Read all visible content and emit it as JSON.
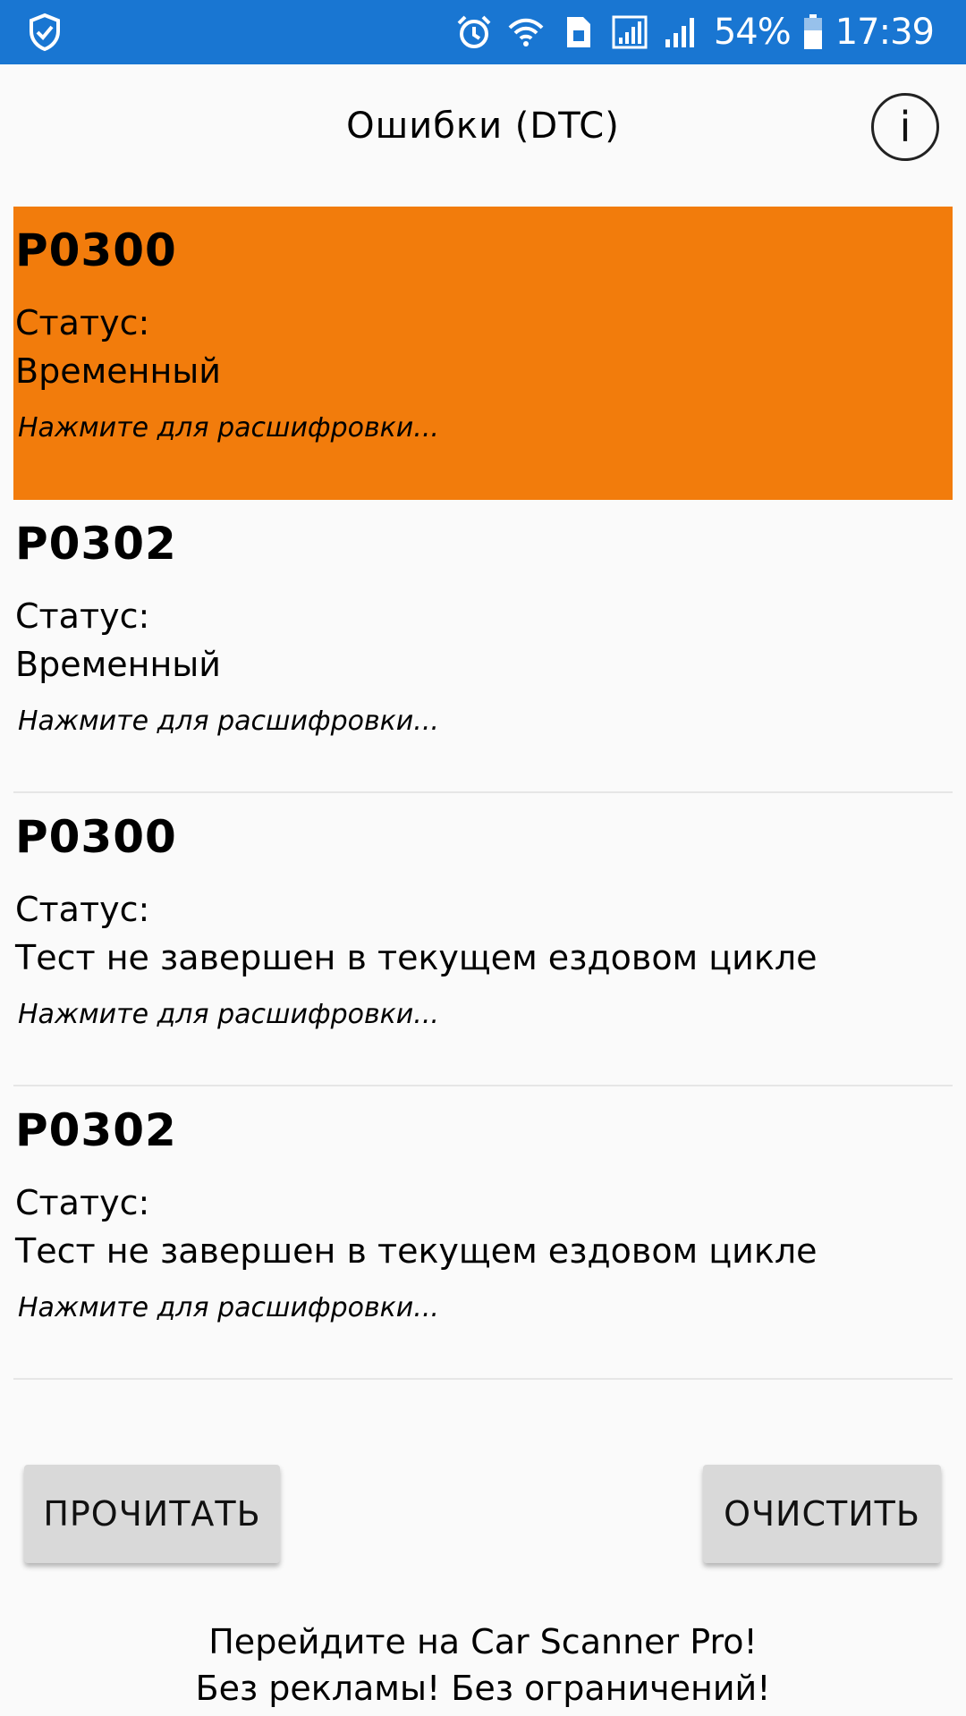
{
  "status_bar": {
    "battery_percent": "54%",
    "time": "17:39",
    "icons": [
      "shield-check-icon",
      "alarm-icon",
      "wifi-icon",
      "sim-card-icon",
      "signal-icon",
      "signal-icon",
      "battery-icon"
    ],
    "background_color": "#1976d2"
  },
  "header": {
    "title": "Ошибки (DTC)",
    "info_icon": "i"
  },
  "dtc_list": {
    "selected_color": "#f27c0c",
    "items": [
      {
        "code": "P0300",
        "status_label": "Статус:",
        "status": "Временный",
        "hint": "Нажмите для расшифровки...",
        "selected": true
      },
      {
        "code": "P0302",
        "status_label": "Статус:",
        "status": "Временный",
        "hint": "Нажмите для расшифровки...",
        "selected": false
      },
      {
        "code": "P0300",
        "status_label": "Статус:",
        "status": "Тест не завершен в текущем ездовом цикле",
        "hint": "Нажмите для расшифровки...",
        "selected": false
      },
      {
        "code": "P0302",
        "status_label": "Статус:",
        "status": "Тест не завершен в текущем ездовом цикле",
        "hint": "Нажмите для расшифровки...",
        "selected": false
      }
    ]
  },
  "actions": {
    "read_label": "ПРОЧИТАТЬ",
    "clear_label": "ОЧИСТИТЬ"
  },
  "promo": {
    "line1": "Перейдите на Car Scanner Pro!",
    "line2": "Без рекламы! Без ограничений!"
  }
}
